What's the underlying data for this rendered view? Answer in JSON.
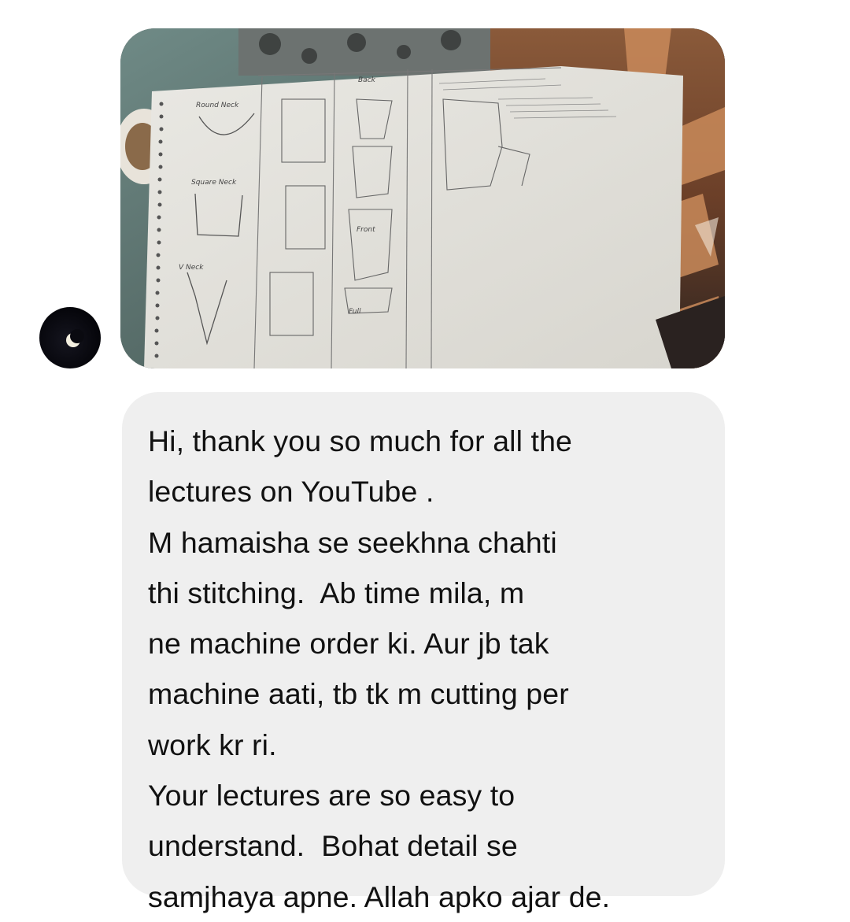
{
  "conversation": {
    "sender_avatar_icon": "crescent-moon-icon",
    "photo_attachment": {
      "icon": "notebook-sketch-photo",
      "sketch_labels": {
        "round_neck": "Round Neck",
        "square_neck": "Square Neck",
        "v_neck": "V Neck",
        "back": "Back",
        "front": "Front",
        "full": "Full"
      }
    },
    "message": {
      "lines": [
        "Hi, thank you so much for all the",
        "lectures on YouTube .",
        "M hamaisha se seekhna chahti",
        "thi stitching.  Ab time mila, m",
        "ne machine order ki. Aur jb tak",
        "machine aati, tb tk m cutting per",
        "work kr ri.",
        "Your lectures are so easy to",
        "understand.  Bohat detail se",
        "samjhaya apne. Allah apko ajar de."
      ]
    }
  }
}
